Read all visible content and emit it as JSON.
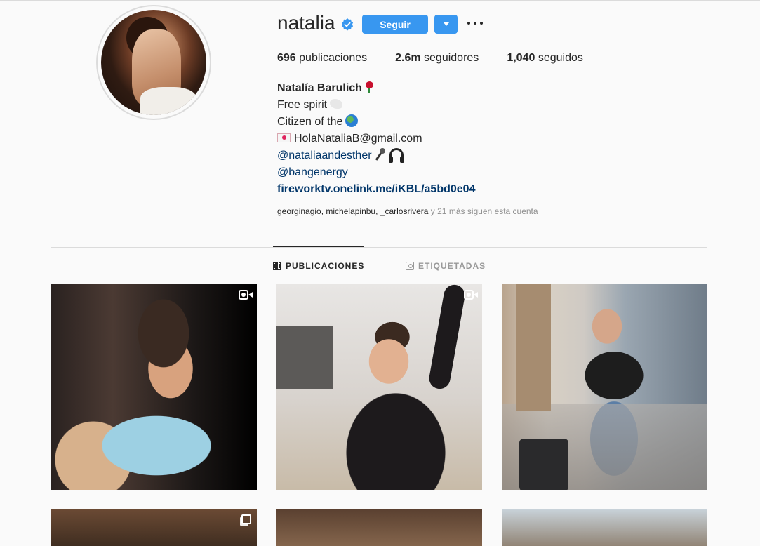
{
  "profile": {
    "username": "natalia",
    "follow_label": "Seguir",
    "stats": {
      "posts_count": "696",
      "posts_label": "publicaciones",
      "followers_count": "2.6m",
      "followers_label": "seguidores",
      "following_count": "1,040",
      "following_label": "seguidos"
    },
    "bio": {
      "full_name": "Natalía Barulich",
      "line1": "Free spirit",
      "line2": "Citizen of the",
      "email": "HolaNataliaB@gmail.com",
      "mention1": "@nataliaandesther",
      "mention2": "@bangenergy",
      "website": "fireworktv.onelink.me/iKBL/a5bd0e04"
    },
    "followed_by": {
      "names": "georginagio, michelapinbu, _carlosrivera",
      "suffix": " y 21 más siguen esta cuenta"
    }
  },
  "tabs": [
    {
      "label": "PUBLICACIONES",
      "active": true
    },
    {
      "label": "ETIQUETADAS",
      "active": false
    }
  ],
  "icons": {
    "verified": "verified-badge-icon",
    "more": "more-options-icon",
    "grid": "grid-icon",
    "tagged": "tagged-icon",
    "video": "video-icon",
    "carousel": "carousel-icon"
  },
  "colors": {
    "accent": "#3897f0",
    "link": "#003569",
    "muted": "#8e8e8e",
    "background": "#fafafa"
  }
}
